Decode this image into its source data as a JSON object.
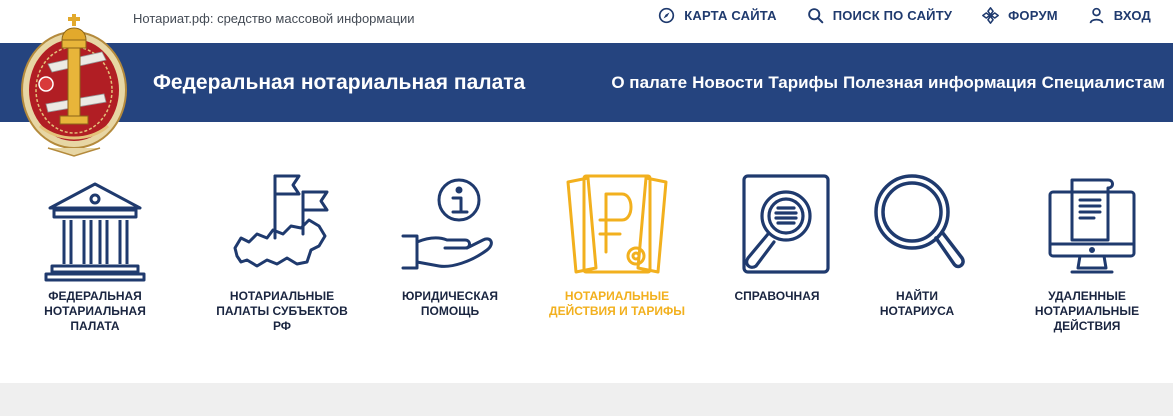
{
  "topbar": {
    "tagline": "Нотариат.рф: средство массовой информации",
    "links": [
      {
        "label": "КАРТА САЙТА",
        "icon": "compass-icon"
      },
      {
        "label": "ПОИСК ПО САЙТУ",
        "icon": "search-icon"
      },
      {
        "label": "ФОРУМ",
        "icon": "forum-icon"
      },
      {
        "label": "ВХОД",
        "icon": "user-icon"
      }
    ]
  },
  "header": {
    "title": "Федеральная нотариальная палата",
    "menu": [
      "О палате",
      "Новости",
      "Тарифы",
      "Полезная информация",
      "Специалистам"
    ],
    "logo_icon": "notary-emblem-icon"
  },
  "tiles": [
    {
      "label": "ФЕДЕРАЛЬНАЯ\nНОТАРИАЛЬНАЯ\nПАЛАТА",
      "icon": "courthouse-icon",
      "active": false
    },
    {
      "label": "НОТАРИАЛЬНЫЕ\nПАЛАТЫ СУБЪЕКТОВ\nРФ",
      "icon": "russia-map-flags-icon",
      "active": false
    },
    {
      "label": "ЮРИДИЧЕСКАЯ\nПОМОЩЬ",
      "icon": "info-hand-icon",
      "active": false
    },
    {
      "label": "НОТАРИАЛЬНЫЕ\nДЕЙСТВИЯ И ТАРИФЫ",
      "icon": "ruble-documents-icon",
      "active": true
    },
    {
      "label": "СПРАВОЧНАЯ",
      "icon": "reference-magnifier-icon",
      "active": false
    },
    {
      "label": "НАЙТИ\nНОТАРИУСА",
      "icon": "magnifier-icon",
      "active": false
    },
    {
      "label": "УДАЛЕННЫЕ\nНОТАРИАЛЬНЫЕ\nДЕЙСТВИЯ",
      "icon": "remote-computer-icon",
      "active": false
    }
  ],
  "colors": {
    "navy": "#25447f",
    "icon_blue": "#1f3a6e",
    "accent_gold": "#f2b01e"
  }
}
